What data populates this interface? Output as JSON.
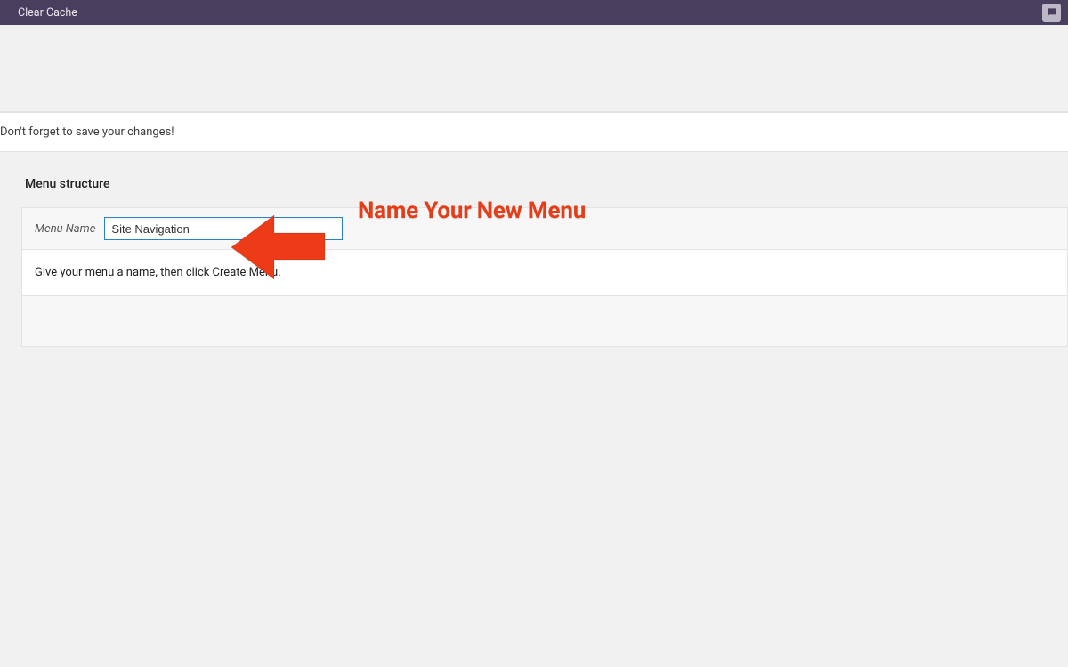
{
  "adminbar": {
    "clear_cache_label": "Clear Cache"
  },
  "notice": {
    "text": "Don't forget to save your changes!"
  },
  "section": {
    "title": "Menu structure"
  },
  "form": {
    "menu_name_label": "Menu Name",
    "menu_name_value": "Site Navigation",
    "instruction_text": "Give your menu a name, then click Create Menu."
  },
  "annotation": {
    "title": "Name Your New Menu"
  }
}
